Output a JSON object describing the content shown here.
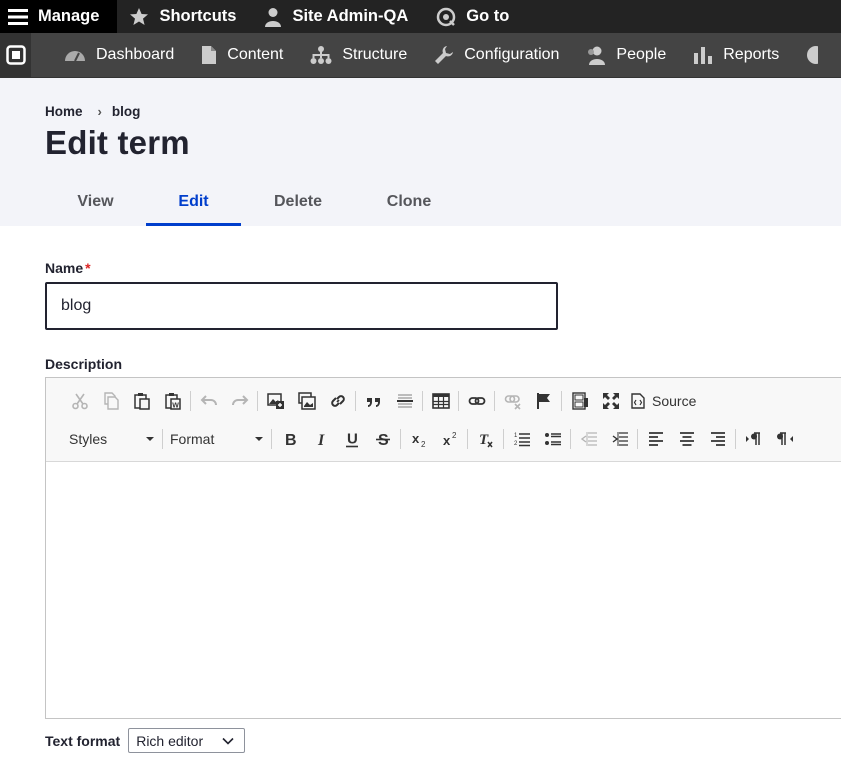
{
  "toolbar": {
    "manage": "Manage",
    "shortcuts": "Shortcuts",
    "user": "Site Admin-QA",
    "goto": "Go to"
  },
  "admin_menu": {
    "dashboard": "Dashboard",
    "content": "Content",
    "structure": "Structure",
    "configuration": "Configuration",
    "people": "People",
    "reports": "Reports"
  },
  "breadcrumb": {
    "home": "Home",
    "separator": "›",
    "current": "blog"
  },
  "page_title": "Edit term",
  "tabs": [
    {
      "label": "View",
      "active": false
    },
    {
      "label": "Edit",
      "active": true
    },
    {
      "label": "Delete",
      "active": false
    },
    {
      "label": "Clone",
      "active": false
    }
  ],
  "form": {
    "name_label": "Name",
    "required_marker": "*",
    "name_value": "blog",
    "description_label": "Description",
    "source_label": "Source",
    "styles_label": "Styles",
    "format_label": "Format",
    "text_format_label": "Text format",
    "text_format_value": "Rich editor"
  },
  "colors": {
    "accent": "#003ecc",
    "toolbar_dark": "#232323",
    "admin_menu": "#444444",
    "header_bg": "#f3f4f9",
    "required": "#dc2323"
  }
}
